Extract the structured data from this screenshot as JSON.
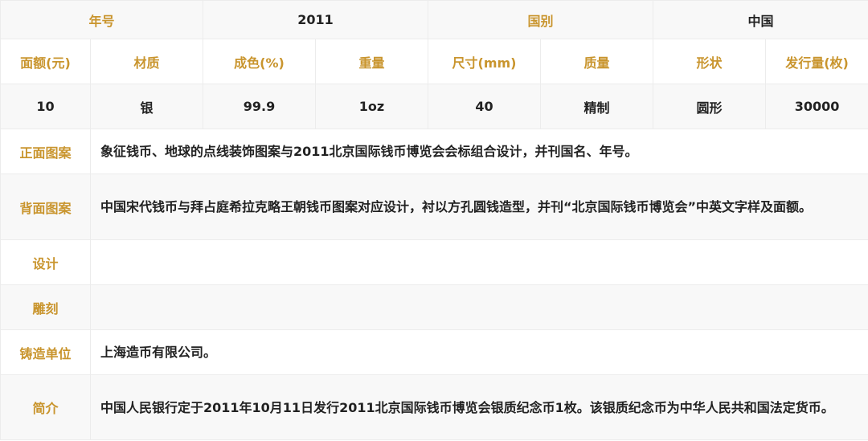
{
  "header": {
    "year_label": "年号",
    "year_value": "2011",
    "country_label": "国别",
    "country_value": "中国"
  },
  "specs": {
    "headers": [
      "面额(元)",
      "材质",
      "成色(%)",
      "重量",
      "尺寸(mm)",
      "质量",
      "形状",
      "发行量(枚)"
    ],
    "values": [
      "10",
      "银",
      "99.9",
      "1oz",
      "40",
      "精制",
      "圆形",
      "30000"
    ]
  },
  "details": [
    {
      "label": "正面图案",
      "value": "象征钱币、地球的点线装饰图案与2011北京国际钱币博览会会标组合设计，并刊国名、年号。"
    },
    {
      "label": "背面图案",
      "value": "中国宋代钱币与拜占庭希拉克略王朝钱币图案对应设计，衬以方孔圆钱造型，并刊“北京国际钱币博览会”中英文字样及面额。"
    },
    {
      "label": "设计",
      "value": ""
    },
    {
      "label": "雕刻",
      "value": ""
    },
    {
      "label": "铸造单位",
      "value": "上海造币有限公司。"
    },
    {
      "label": "简介",
      "value": "中国人民银行定于2011年10月11日发行2011北京国际钱币博览会银质纪念币1枚。该银质纪念币为中华人民共和国法定货币。"
    }
  ]
}
